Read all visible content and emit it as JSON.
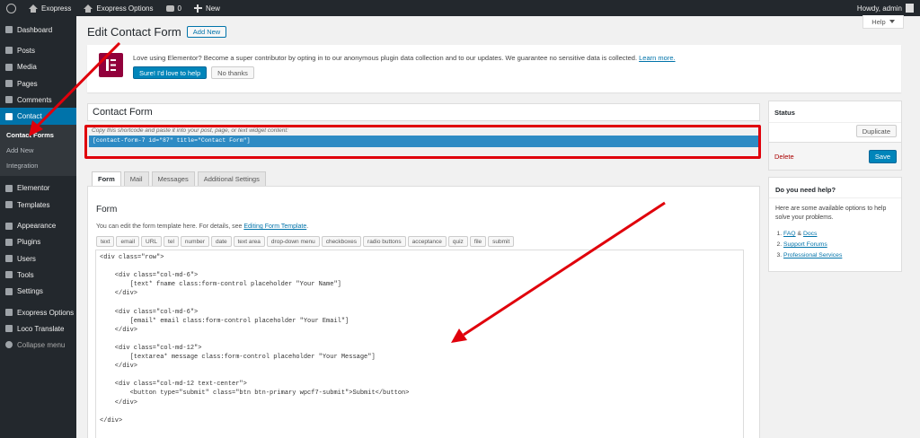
{
  "adminbar": {
    "site_name": "Exopress",
    "options": "Exopress Options",
    "comments_count": "0",
    "new_label": "New",
    "howdy": "Howdy, admin"
  },
  "sidebar": {
    "items": [
      {
        "label": "Dashboard"
      },
      {
        "label": "Posts"
      },
      {
        "label": "Media"
      },
      {
        "label": "Pages"
      },
      {
        "label": "Comments"
      },
      {
        "label": "Contact"
      }
    ],
    "contact_sub": [
      "Contact Forms",
      "Add New",
      "Integration"
    ],
    "items2": [
      {
        "label": "Elementor"
      },
      {
        "label": "Templates"
      }
    ],
    "items3": [
      {
        "label": "Appearance"
      },
      {
        "label": "Plugins"
      },
      {
        "label": "Users"
      },
      {
        "label": "Tools"
      },
      {
        "label": "Settings"
      }
    ],
    "items4": [
      {
        "label": "Exopress Options"
      },
      {
        "label": "Loco Translate"
      }
    ],
    "collapse": "Collapse menu"
  },
  "help_tab": "Help",
  "page": {
    "title": "Edit Contact Form",
    "add_new": "Add New"
  },
  "notice": {
    "text": "Love using Elementor? Become a super contributor by opting in to our anonymous plugin data collection and to our updates. We guarantee no sensitive data is collected.",
    "link": "Learn more.",
    "accept": "Sure! I'd love to help",
    "decline": "No thanks"
  },
  "form": {
    "title_value": "Contact Form",
    "shortcode_hint": "Copy this shortcode and paste it into your post, page, or text widget content:",
    "shortcode": "[contact-form-7 id=\"87\" title=\"Contact Form\"]",
    "tabs": [
      "Form",
      "Mail",
      "Messages",
      "Additional Settings"
    ],
    "heading": "Form",
    "desc": "You can edit the form template here. For details, see",
    "desc_link": "Editing Form Template",
    "tag_buttons": [
      "text",
      "email",
      "URL",
      "tel",
      "number",
      "date",
      "text area",
      "drop-down menu",
      "checkboxes",
      "radio buttons",
      "acceptance",
      "quiz",
      "file",
      "submit"
    ],
    "code": "<div class=\"row\">\n\n    <div class=\"col-md-6\">\n        [text* fname class:form-control placeholder \"Your Name\"]\n    </div>\n\n    <div class=\"col-md-6\">\n        [email* email class:form-control placeholder \"Your Email\"]\n    </div>\n\n    <div class=\"col-md-12\">\n        [textarea* message class:form-control placeholder \"Your Message\"]\n    </div>\n\n    <div class=\"col-md-12 text-center\">\n        <button type=\"submit\" class=\"btn btn-primary wpcf7-submit\">Submit</button>\n    </div>\n\n</div>"
  },
  "status": {
    "heading": "Status",
    "duplicate": "Duplicate",
    "delete": "Delete",
    "save": "Save"
  },
  "help": {
    "heading": "Do you need help?",
    "text": "Here are some available options to help solve your problems.",
    "faq": "FAQ",
    "amp": "&",
    "docs": "Docs",
    "support": "Support Forums",
    "pro": "Professional Services"
  },
  "colors": {
    "accent": "#0073aa",
    "highlight": "#e0000b",
    "sidebar": "#23282d"
  }
}
